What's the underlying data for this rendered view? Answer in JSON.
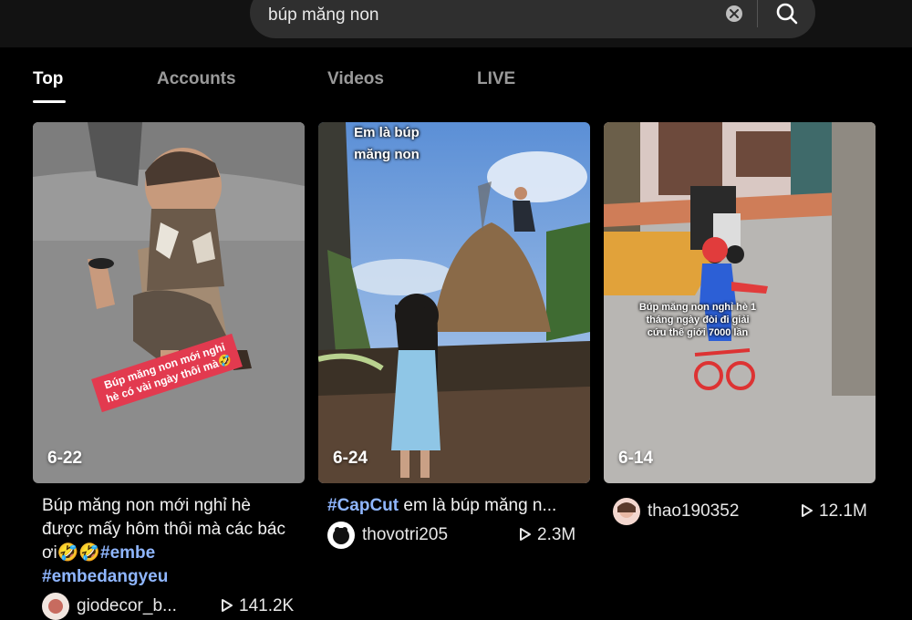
{
  "search": {
    "query": "búp măng non"
  },
  "tabs": [
    {
      "label": "Top"
    },
    {
      "label": "Accounts"
    },
    {
      "label": "Videos"
    },
    {
      "label": "LIVE"
    }
  ],
  "videos": [
    {
      "date": "6-22",
      "overlay": "Búp măng non mới nghỉ\nhè có vài ngày thôi mà🤣",
      "desc_text": "Búp măng non mới nghỉ hè được mấy hôm thôi mà các bác ơi🤣🤣",
      "desc_tags": [
        "#embe",
        "#embedangyeu"
      ],
      "author": "giodecor_b...",
      "views": "141.2K"
    },
    {
      "date": "6-24",
      "overlay": "Em là búp\nmăng non",
      "desc_tag": "#CapCut",
      "desc_text": " em là búp măng n...",
      "author": "thovotri205",
      "views": "2.3M"
    },
    {
      "date": "6-14",
      "overlay": "Búp măng non nghỉ hè 1\ntháng ngày đòi đi giải\ncứu thế giới 7000 lần",
      "author": "thao190352",
      "views": "12.1M"
    }
  ],
  "colors": {
    "background": "#000000",
    "hashtag": "#8fb6ff",
    "overlay_red": "#e23a4f"
  },
  "icons": [
    "close-icon",
    "search-icon",
    "play-icon"
  ]
}
